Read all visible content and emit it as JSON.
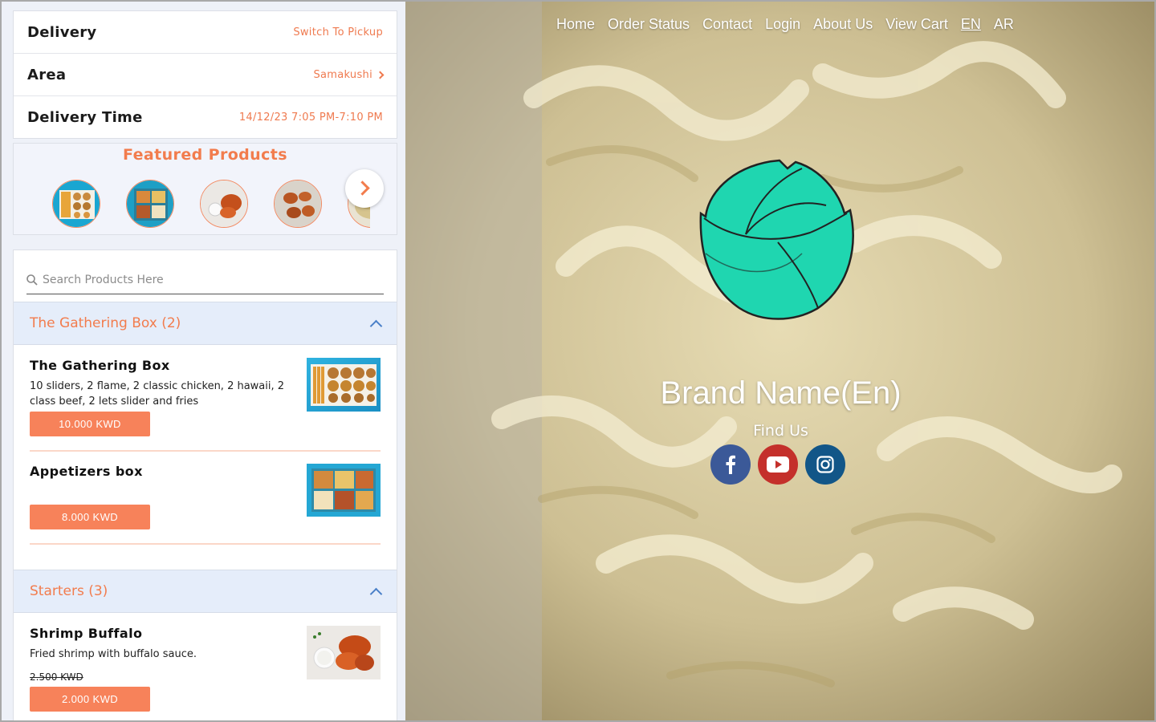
{
  "delivery": {
    "rows": [
      {
        "label": "Delivery",
        "value": "Switch To Pickup"
      },
      {
        "label": "Area",
        "value": "Samakushi"
      },
      {
        "label": "Delivery Time",
        "value": "14/12/23 7:05 PM-7:10 PM"
      }
    ]
  },
  "featured": {
    "title": "Featured Products",
    "items": [
      "burger-box-thumb",
      "appetizer-box-thumb",
      "shrimp-buffalo-thumb",
      "wings-thumb",
      "pasta-thumb"
    ]
  },
  "search": {
    "placeholder": "Search Products Here"
  },
  "categories": [
    {
      "title": "The Gathering Box (2)",
      "products": [
        {
          "name": "The Gathering Box",
          "description": "10 sliders, 2 flame, 2 classic chicken, 2 hawaii, 2 class beef, 2 lets slider and fries",
          "price": "10.000 KWD"
        },
        {
          "name": "Appetizers box",
          "description": "",
          "price": "8.000 KWD"
        }
      ]
    },
    {
      "title": "Starters (3)",
      "products": [
        {
          "name": "Shrimp Buffalo",
          "description": "Fried shrimp with buffalo sauce.",
          "old_price": "2.500 KWD",
          "price": "2.000 KWD"
        }
      ]
    }
  ],
  "nav": {
    "items": [
      "Home",
      "Order Status",
      "Contact",
      "Login",
      "About Us",
      "View Cart",
      "EN",
      "AR"
    ],
    "active": "EN"
  },
  "hero": {
    "brand_name": "Brand Name(En)",
    "find_us": "Find Us",
    "socials": [
      {
        "icon": "facebook-icon",
        "color": "#3b5998"
      },
      {
        "icon": "youtube-icon",
        "color": "#c4302b"
      },
      {
        "icon": "instagram-icon",
        "color": "#125688"
      }
    ]
  },
  "colors": {
    "accent": "#f7825a",
    "category_bg": "#e5edfa",
    "logo": "#1fd6b0"
  }
}
